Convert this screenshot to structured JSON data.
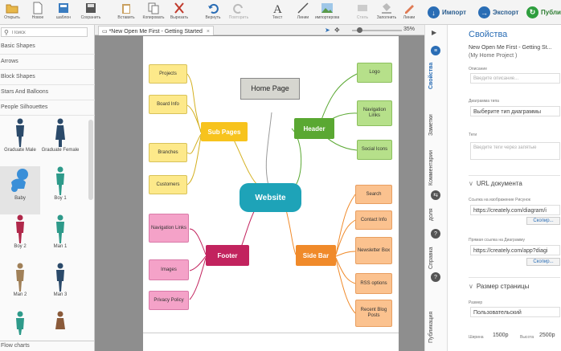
{
  "toolbar": {
    "buttons": [
      {
        "label": "Открыть",
        "icon": "folder-open-icon"
      },
      {
        "label": "Новое",
        "icon": "new-document-icon"
      },
      {
        "label": "шаблон",
        "icon": "template-icon"
      },
      {
        "label": "Сохранить",
        "icon": "save-icon"
      },
      {
        "label": "Вставить",
        "icon": "paste-icon"
      },
      {
        "label": "Копировать",
        "icon": "copy-icon"
      },
      {
        "label": "Вырезать",
        "icon": "scissors-icon"
      },
      {
        "label": "Вернуть",
        "icon": "undo-icon"
      },
      {
        "label": "Повторить",
        "icon": "redo-icon"
      },
      {
        "label": "Текст",
        "icon": "text-icon"
      },
      {
        "label": "Линии",
        "icon": "line-icon"
      },
      {
        "label": "импортировать",
        "icon": "image-import-icon"
      },
      {
        "label": "Стиль",
        "icon": "style-icon"
      },
      {
        "label": "Заполнить",
        "icon": "fill-icon"
      },
      {
        "label": "Линии",
        "icon": "pen-icon"
      }
    ],
    "import_label": "Импорт",
    "export_label": "Экспорт",
    "publish_label": "Публи"
  },
  "left_panel": {
    "search_placeholder": "Поиск",
    "categories": [
      "Basic Shapes",
      "Arrows",
      "Block Shapes",
      "Stars And Balloons",
      "People Silhouettes"
    ],
    "shapes": [
      "Graduate Male",
      "Graduate Female",
      "Baby",
      "Boy 1",
      "Boy 2",
      "Man 1",
      "Man 2",
      "Man 3",
      "",
      ""
    ],
    "footer_category": "Flow charts"
  },
  "canvas": {
    "tab_title": "*New Open Me First - Getting Started",
    "zoom": "35%",
    "nodes": {
      "home_page": "Home Page",
      "website": "Website",
      "sub_pages": "Sub Pages",
      "header": "Header",
      "footer": "Footer",
      "side_bar": "Side Bar",
      "projects": "Projects",
      "board_info": "Board Info",
      "branches": "Branches",
      "customers": "Customers",
      "logo": "Logo",
      "navigation_links_header": "Navigation Links",
      "social_icons": "Social Icons",
      "navigation_links_footer": "Navigation Links",
      "images": "Images",
      "privacy_policy": "Privacy Policy",
      "search": "Search",
      "contact_info": "Contact Info",
      "newsletter_box": "Newsletter Box",
      "rss_options": "RSS options",
      "recent_blog_posts": "Recent Blog Posts"
    }
  },
  "right_panel": {
    "vertical_tabs": [
      "Свойства",
      "Заметки",
      "Комментарии",
      "доля",
      "Справка",
      "Публикация"
    ],
    "title": "Свойства",
    "doc_title_line1": "New Open Me First - Getting St...",
    "doc_title_line2": "(My Home Project )",
    "desc_label": "Описание",
    "desc_placeholder": "Введите описание...",
    "diagram_type_label": "Диаграмма типа",
    "diagram_type_value": "Выберите тип диаграммы",
    "tags_label": "Теги",
    "tags_placeholder": "Введите теги через запятые",
    "url_section": "URL документа",
    "image_link_label": "Ссылка на изображение Рисунок",
    "image_link_value": "https://creately.com/diagram/i",
    "copy_button": "Скопир...",
    "diagram_link_label": "Прямая ссылка на Диаграмму",
    "diagram_link_value": "https://creately.com/app?diagi",
    "page_size_section": "Размер страницы",
    "size_label": "Размер",
    "size_value": "Пользовательский",
    "width_label": "Ширина",
    "width_value": "1500p",
    "height_label": "Высота",
    "height_value": "2500p"
  },
  "colors": {
    "accent": "#2a6db5",
    "hub_teal": "#1ea3b8",
    "sub_pages": "#f7c31d",
    "header": "#5aa832",
    "footer": "#c2235e",
    "side_bar": "#f08a2a"
  }
}
